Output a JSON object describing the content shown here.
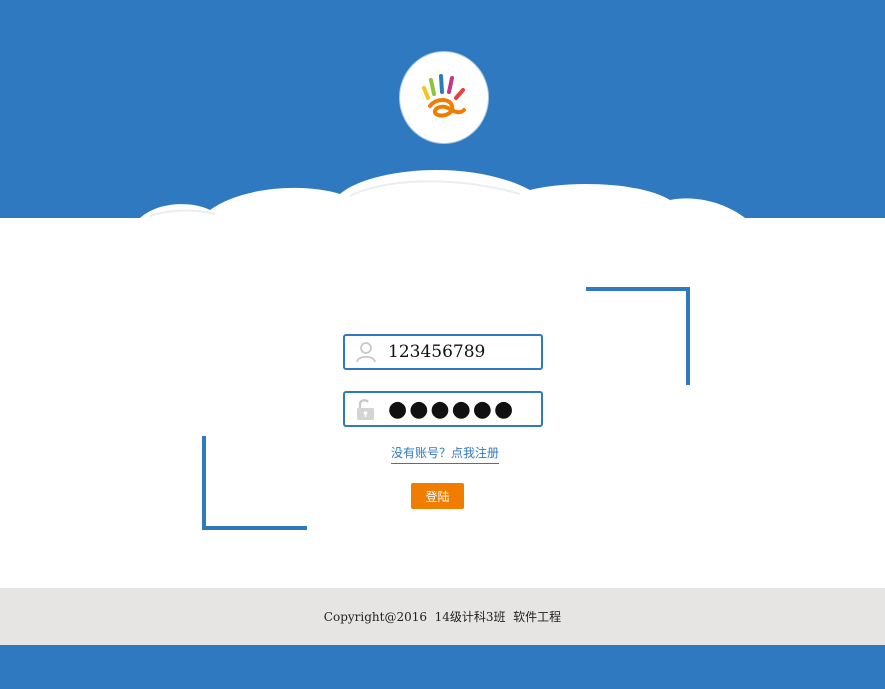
{
  "colors": {
    "header_blue": "#2f79c1",
    "accent_blue": "#2f79c1",
    "button_orange": "#f07d00",
    "footer_gray": "#e6e5e3"
  },
  "logo": {
    "icon": "hand-logo-icon"
  },
  "login_form": {
    "username": {
      "value": "123456789",
      "icon": "user-icon"
    },
    "password": {
      "value": "●●●●●●",
      "icon": "lock-icon"
    },
    "register_link": "没有账号？点我注册",
    "login_button": "登陆"
  },
  "footer": {
    "copyright": "Copyright@2016  14级计科3班  软件工程"
  }
}
